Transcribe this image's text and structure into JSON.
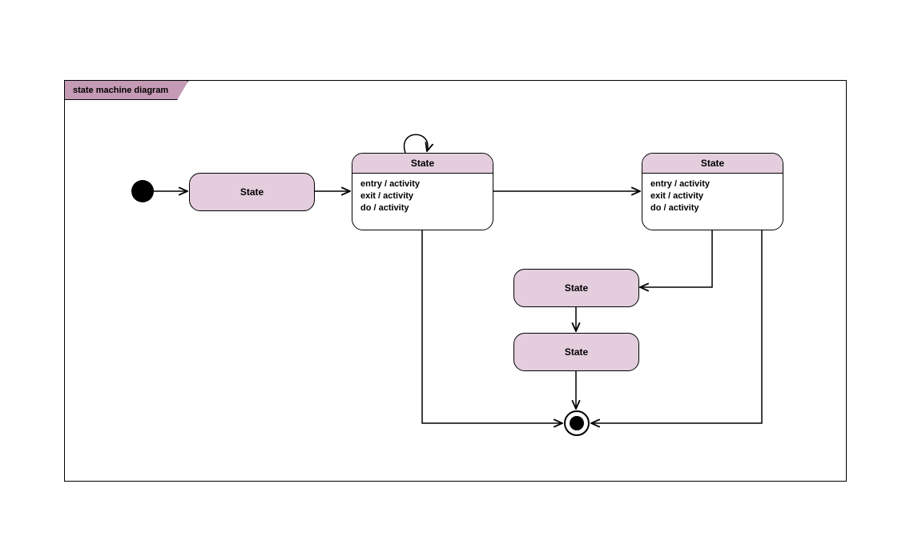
{
  "frame": {
    "title": "state machine diagram"
  },
  "states": {
    "s1": {
      "label": "State"
    },
    "s2": {
      "label": "State",
      "activities": {
        "entry": "entry / activity",
        "exit": "exit / activity",
        "do": "do / activity"
      }
    },
    "s3": {
      "label": "State",
      "activities": {
        "entry": "entry / activity",
        "exit": "exit / activity",
        "do": "do / activity"
      }
    },
    "s4": {
      "label": "State"
    },
    "s5": {
      "label": "State"
    }
  },
  "colors": {
    "fill": "#e4cede",
    "tab": "#c49ab4",
    "stroke": "#000000"
  }
}
